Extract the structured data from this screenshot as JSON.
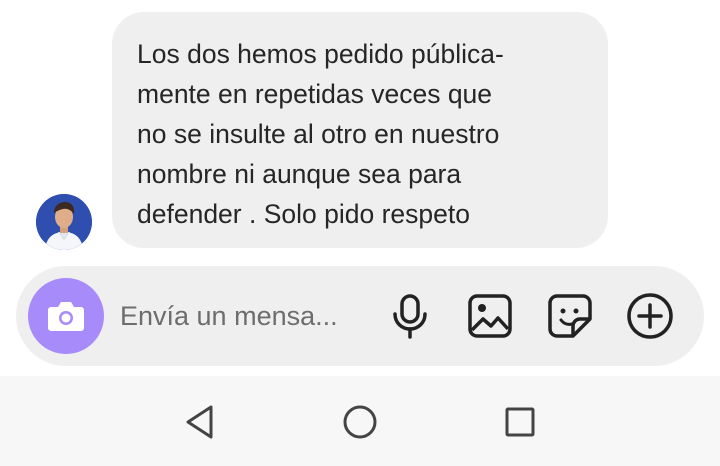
{
  "message": {
    "lines": [
      "Los dos hemos pedido pública-",
      "mente en repetidas veces que",
      "no se insulte al otro en nuestro",
      "nombre ni aunque sea para",
      "defender . Solo pido respeto"
    ]
  },
  "composer": {
    "placeholder": "Envía un mensa...",
    "accent_color": "#a78bfa",
    "icons": [
      "camera-icon",
      "microphone-icon",
      "gallery-icon",
      "sticker-icon",
      "plus-icon"
    ]
  },
  "navigation": {
    "icons": [
      "back-icon",
      "home-icon",
      "recents-icon"
    ]
  }
}
